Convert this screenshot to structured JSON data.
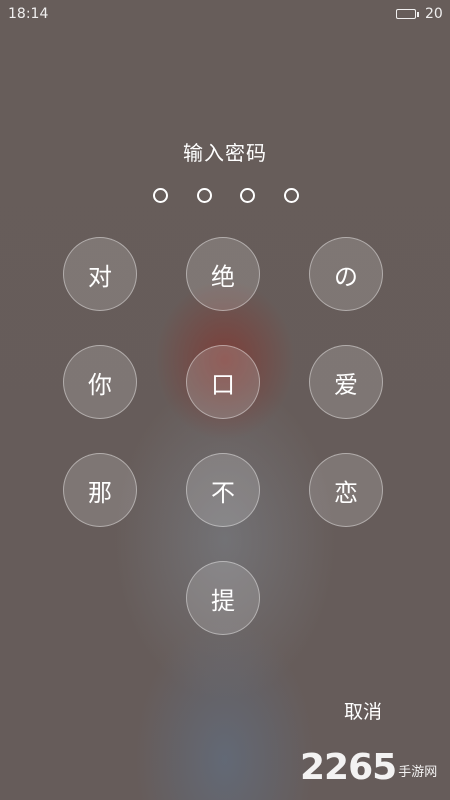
{
  "status_bar": {
    "time": "18:14",
    "battery_level": "20",
    "battery_fraction": 0.2
  },
  "prompt": "输入密码",
  "pin": {
    "length": 4,
    "entered": 0
  },
  "keypad": {
    "keys": [
      "对",
      "绝",
      "の",
      "你",
      "口",
      "爱",
      "那",
      "不",
      "恋",
      "提"
    ]
  },
  "cancel_label": "取消",
  "watermark": {
    "number": "2265",
    "text": "手游网"
  },
  "colors": {
    "background": "#675d5a",
    "text": "#ffffff"
  }
}
